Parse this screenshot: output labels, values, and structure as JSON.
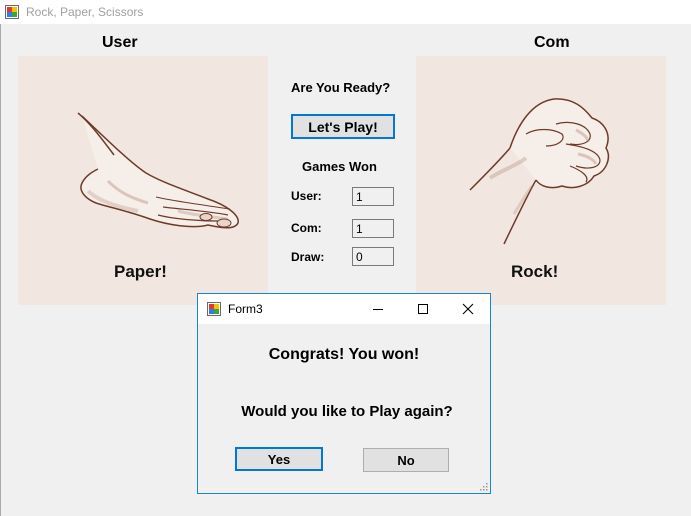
{
  "window": {
    "title": "Rock, Paper, Scissors",
    "icon": "winforms-app-icon"
  },
  "user_side": {
    "heading": "User",
    "choice_image": "paper-hand",
    "choice_label": "Paper!"
  },
  "com_side": {
    "heading": "Com",
    "choice_image": "rock-fist",
    "choice_label": "Rock!"
  },
  "center": {
    "ready_label": "Are You Ready?",
    "play_button": "Let's Play!",
    "games_won_heading": "Games Won",
    "scores": [
      {
        "label": "User:",
        "value": "1"
      },
      {
        "label": "Com:",
        "value": "1"
      },
      {
        "label": "Draw:",
        "value": "0"
      }
    ]
  },
  "dialog": {
    "title": "Form3",
    "icon": "winforms-app-icon",
    "message": "Congrats! You won!",
    "question": "Would you like to Play again?",
    "yes_button": "Yes",
    "no_button": "No",
    "controls": [
      "minimize-icon",
      "maximize-icon",
      "close-icon"
    ]
  },
  "colors": {
    "accent": "#0078d7",
    "panel_bg": "#f1e7e0",
    "sketch_line": "#6e3b2a"
  }
}
